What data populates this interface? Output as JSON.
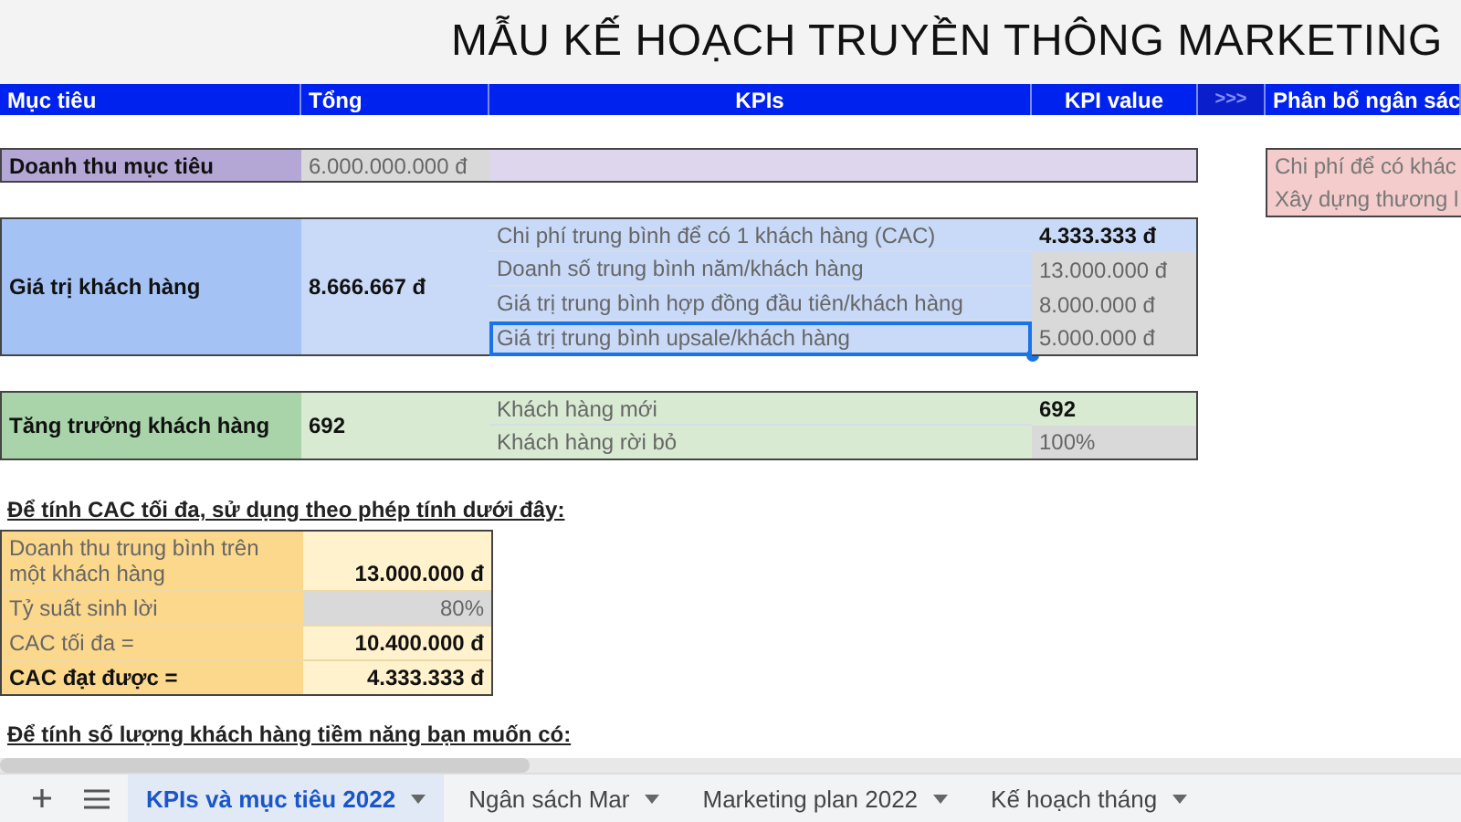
{
  "title": "MẪU KẾ HOẠCH TRUYỀN THÔNG MARKETING",
  "header": [
    "Mục tiêu",
    "Tổng",
    "KPIs",
    "KPI value"
  ],
  "header_arrow": ">>>",
  "header_budget": "Phân bổ ngân sác",
  "revenue": {
    "label": "Doanh thu mục tiêu",
    "total": "6.000.000.000 đ"
  },
  "budget_items": [
    "Chi phí để có khác",
    "Xây dựng thương l"
  ],
  "customer_value": {
    "label": "Giá trị khách hàng",
    "total": "8.666.667 đ",
    "kpis": [
      {
        "name": "Chi phí trung bình để có 1 khách hàng (CAC)",
        "value": "4.333.333 đ",
        "bold": true,
        "selected": false
      },
      {
        "name": "Doanh số trung bình năm/khách hàng",
        "value": "13.000.000 đ",
        "bold": false,
        "selected": false
      },
      {
        "name": "Giá trị trung bình hợp đồng đầu tiên/khách hàng",
        "value": "8.000.000 đ",
        "bold": false,
        "selected": false
      },
      {
        "name": "Giá trị trung bình upsale/khách hàng",
        "value": "5.000.000 đ",
        "bold": false,
        "selected": true
      }
    ]
  },
  "growth": {
    "label": "Tăng trưởng khách hàng",
    "total": "692",
    "kpis": [
      {
        "name": "Khách hàng mới",
        "value": "692",
        "bold": true,
        "selected": false
      },
      {
        "name": "Khách hàng rời bỏ",
        "value": "100%",
        "bold": false,
        "selected": false
      }
    ]
  },
  "cac_heading": "Để tính CAC tối đa, sử dụng theo phép tính dưới đây:",
  "cac_rows": [
    {
      "label": "Doanh thu trung bình trên một khách hàng",
      "value": "13.000.000 đ",
      "label_bold": false,
      "value_bold": true,
      "shaded": false
    },
    {
      "label": "Tỷ suất sinh lời",
      "value": "80%",
      "label_bold": false,
      "value_bold": false,
      "shaded": true
    },
    {
      "label": "CAC tối đa =",
      "value": "10.400.000 đ",
      "label_bold": false,
      "value_bold": true,
      "shaded": false
    },
    {
      "label": "CAC đạt được =",
      "value": "4.333.333 đ",
      "label_bold": true,
      "value_bold": true,
      "shaded": false
    }
  ],
  "potential_heading": "Để tính số lượng khách hàng tiềm năng bạn muốn có:",
  "sheet_tabs": [
    {
      "label": "KPIs và mục tiêu 2022",
      "selected": true
    },
    {
      "label": "Ngân sách Mar",
      "selected": false
    },
    {
      "label": "Marketing plan 2022",
      "selected": false
    },
    {
      "label": "Kế hoạch tháng",
      "selected": false
    }
  ]
}
